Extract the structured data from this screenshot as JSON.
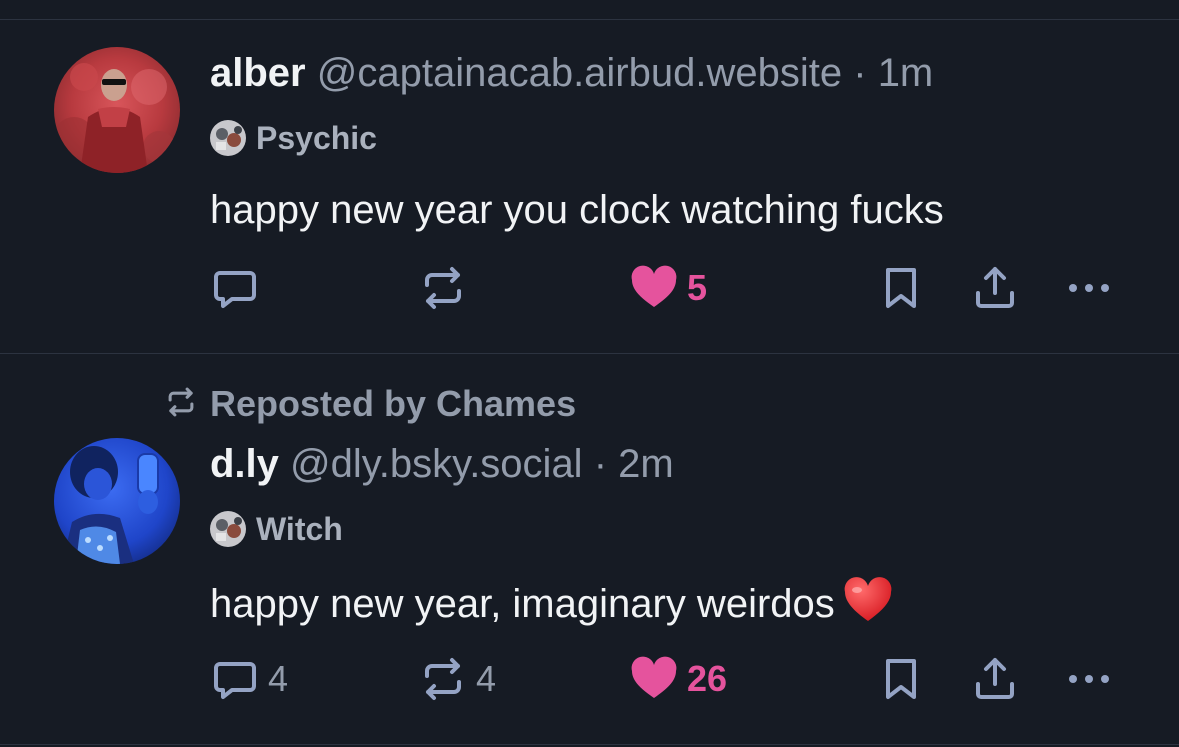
{
  "theme": {
    "background": "#161b24",
    "divider": "#2c3340",
    "text_primary": "#f1f3f5",
    "text_secondary": "#939cab",
    "like_color": "#e5539d",
    "icon_color": "#94a3c4"
  },
  "posts": [
    {
      "display_name": "alber",
      "handle": "@captainacab.airbud.website",
      "separator": "·",
      "time": "1m",
      "badge": {
        "icon": "psychic-badge-icon",
        "label": "Psychic"
      },
      "text": "happy new year you clock watching fucks",
      "actions": {
        "reply_count": "",
        "repost_count": "",
        "like_count": "5",
        "liked": true
      }
    },
    {
      "repost_label": "Reposted by Chames",
      "display_name": "d.ly",
      "handle": "@dly.bsky.social",
      "separator": "·",
      "time": "2m",
      "badge": {
        "icon": "witch-badge-icon",
        "label": "Witch"
      },
      "text": "happy new year, imaginary weirdos",
      "emoji": "red-heart-emoji",
      "actions": {
        "reply_count": "4",
        "repost_count": "4",
        "like_count": "26",
        "liked": true
      }
    }
  ]
}
